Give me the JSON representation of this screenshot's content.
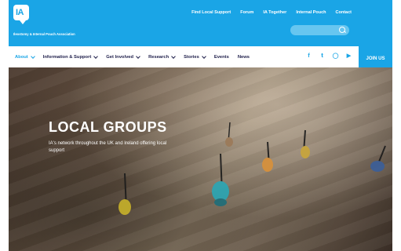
{
  "logo": {
    "initials": "IA",
    "org_name": "Ileostomy & Internal Pouch Association"
  },
  "top_links": [
    "Find Local Support",
    "Forum",
    "IA Together",
    "Internal Pouch",
    "Contact"
  ],
  "search": {
    "placeholder": ""
  },
  "nav": [
    {
      "label": "About",
      "active": true,
      "dropdown": true
    },
    {
      "label": "Information & Support",
      "active": false,
      "dropdown": true
    },
    {
      "label": "Get Involved",
      "active": false,
      "dropdown": true
    },
    {
      "label": "Research",
      "active": false,
      "dropdown": true
    },
    {
      "label": "Stories",
      "active": false,
      "dropdown": true
    },
    {
      "label": "Events",
      "active": false,
      "dropdown": false
    },
    {
      "label": "News",
      "active": false,
      "dropdown": false
    }
  ],
  "social": [
    "facebook-icon",
    "twitter-icon",
    "instagram-icon",
    "youtube-icon"
  ],
  "join_label": "JOIN US",
  "hero": {
    "title": "LOCAL GROUPS",
    "subtitle": "IA's network throughout the UK and Ireland offering local support"
  },
  "colors": {
    "brand": "#1aa5e6",
    "nav_text": "#1e1e4a"
  }
}
